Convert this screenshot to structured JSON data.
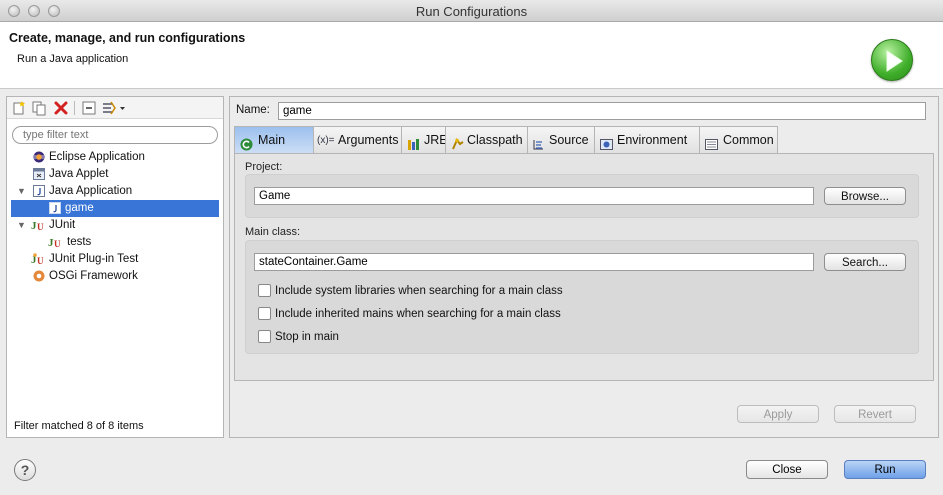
{
  "window": {
    "title": "Run Configurations"
  },
  "header": {
    "title": "Create, manage, and run configurations",
    "subtitle": "Run a Java application",
    "run_icon": "run-play-icon"
  },
  "left_panel": {
    "toolbar": [
      "new-configuration-icon",
      "duplicate-icon",
      "delete-icon",
      "collapse-all-icon",
      "filter-icon"
    ],
    "filter_placeholder": "type filter text",
    "tree": [
      {
        "label": "Eclipse Application",
        "icon": "eclipse-icon",
        "expanded": null,
        "selected": false
      },
      {
        "label": "Java Applet",
        "icon": "java-applet-icon",
        "expanded": null,
        "selected": false
      },
      {
        "label": "Java Application",
        "icon": "java-application-icon",
        "expanded": true,
        "selected": false
      },
      {
        "label": "game",
        "icon": "java-config-icon",
        "expanded": null,
        "selected": true
      },
      {
        "label": "JUnit",
        "icon": "junit-icon",
        "expanded": true,
        "selected": false
      },
      {
        "label": "tests",
        "icon": "junit-config-icon",
        "expanded": null,
        "selected": false
      },
      {
        "label": "JUnit Plug-in Test",
        "icon": "junit-plugin-icon",
        "expanded": null,
        "selected": false
      },
      {
        "label": "OSGi Framework",
        "icon": "osgi-icon",
        "expanded": null,
        "selected": false
      }
    ],
    "filter_status": "Filter matched 8 of 8 items"
  },
  "right_panel": {
    "name_label": "Name:",
    "name_value": "game",
    "tabs": [
      {
        "label": "Main",
        "icon": "main-tab-icon",
        "active": true
      },
      {
        "label": "Arguments",
        "icon": "arguments-icon",
        "active": false
      },
      {
        "label": "JRE",
        "icon": "jre-icon",
        "active": false
      },
      {
        "label": "Classpath",
        "icon": "classpath-icon",
        "active": false
      },
      {
        "label": "Source",
        "icon": "source-icon",
        "active": false
      },
      {
        "label": "Environment",
        "icon": "environment-icon",
        "active": false
      },
      {
        "label": "Common",
        "icon": "common-icon",
        "active": false
      }
    ],
    "project": {
      "label": "Project:",
      "value": "Game",
      "browse_label": "Browse..."
    },
    "main_class": {
      "label": "Main class:",
      "value": "stateContainer.Game",
      "search_label": "Search...",
      "options": [
        {
          "label": "Include system libraries when searching for a main class",
          "checked": false
        },
        {
          "label": "Include inherited mains when searching for a main class",
          "checked": false
        },
        {
          "label": "Stop in main",
          "checked": false
        }
      ]
    },
    "apply_label": "Apply",
    "revert_label": "Revert"
  },
  "footer": {
    "help_icon": "help-icon",
    "help_glyph": "?",
    "close_label": "Close",
    "run_label": "Run"
  }
}
